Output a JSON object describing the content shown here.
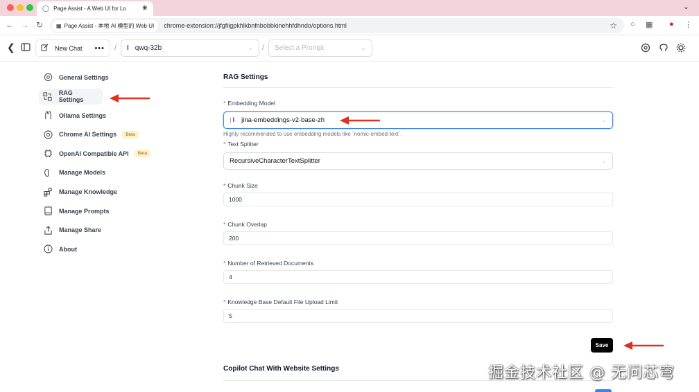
{
  "browser": {
    "tab_title": "Page Assist - A Web UI for Lo",
    "origin_chip": "Page Assist - 本地 AI 模型的 Web UI",
    "url": "chrome-extension://jfgfiigpkhlkbnfnbobbkinehhfdhndo/options.html"
  },
  "header": {
    "new_chat_label": "New Chat",
    "more_label": "•••",
    "model_value": "qwq-32b",
    "prompt_placeholder": "Select a Prompt",
    "separator": "/"
  },
  "sidebar": {
    "items": [
      {
        "label": "General Settings",
        "icon": "gear-icon"
      },
      {
        "label": "RAG Settings",
        "icon": "rag-icon",
        "active": true
      },
      {
        "label": "Ollama Settings",
        "icon": "llama-icon"
      },
      {
        "label": "Chrome AI Settings",
        "icon": "chrome-icon",
        "badge": "Beta"
      },
      {
        "label": "OpenAI Compatible API",
        "icon": "cpu-icon",
        "badge": "Beta"
      },
      {
        "label": "Manage Models",
        "icon": "brain-icon"
      },
      {
        "label": "Manage Knowledge",
        "icon": "blocks-icon"
      },
      {
        "label": "Manage Prompts",
        "icon": "book-icon"
      },
      {
        "label": "Manage Share",
        "icon": "share-icon"
      },
      {
        "label": "About",
        "icon": "info-icon"
      }
    ]
  },
  "main": {
    "title": "RAG Settings",
    "embedding_label": "Embedding Model",
    "embedding_value": "jina-embeddings-v2-base-zh",
    "embedding_help": "Highly recommended to use embedding models like `nomic-embed-text`.",
    "splitter_label": "Text Splitter",
    "splitter_value": "RecursiveCharacterTextSplitter",
    "chunk_size_label": "Chunk Size",
    "chunk_size_value": "1000",
    "chunk_overlap_label": "Chunk Overlap",
    "chunk_overlap_value": "200",
    "retrieved_label": "Number of Retrieved Documents",
    "retrieved_value": "4",
    "upload_limit_label": "Knowledge Base Default File Upload Limit",
    "upload_limit_value": "5",
    "save_label": "Save",
    "copilot_title": "Copilot Chat With Website Settings"
  },
  "watermark": "掘金技术社区 @ 无问芯穹",
  "colors": {
    "tab_strip": "#f3d4dd",
    "arrow": "#e0301e",
    "required": "#ef4444",
    "focus": "#3b82f6",
    "beta_bg": "#fef3c7"
  }
}
